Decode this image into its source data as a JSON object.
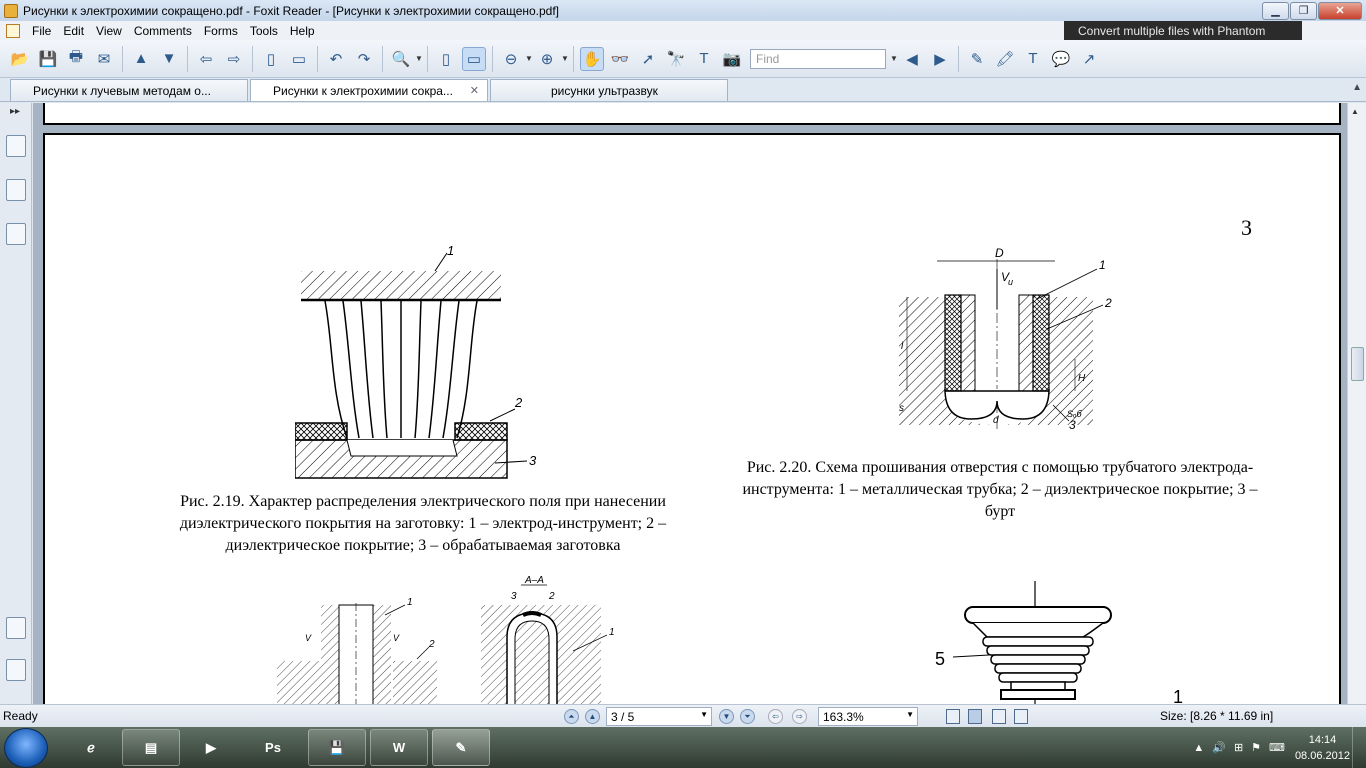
{
  "window": {
    "title": "Рисунки к электрохимии сокращено.pdf - Foxit Reader - [Рисунки к электрохимии сокращено.pdf]",
    "minimize": "▁",
    "maximize": "❐",
    "close": "✕"
  },
  "menu": [
    "File",
    "Edit",
    "View",
    "Comments",
    "Forms",
    "Tools",
    "Help"
  ],
  "promo_text": "Convert multiple files with Phantom",
  "toolbar": {
    "find_placeholder": "Find",
    "icons": {
      "open": "📂",
      "save": "💾",
      "print": "🖶",
      "email": "✉",
      "prev_page": "▲",
      "next_page": "▼",
      "back": "⇦",
      "forward": "⇨",
      "undo": "↶",
      "redo": "↷",
      "zoom_in": "🔍",
      "fit_page": "▯",
      "fit_width": "▭",
      "zoom_out": "⊖",
      "zoom_plus": "⊕",
      "hand": "✋",
      "select_text": "👓",
      "select": "➚",
      "snapshot_find": "🔭",
      "typewriter": "T",
      "camera": "📷",
      "find_prev": "◀",
      "find_next": "▶",
      "note": "✎",
      "highlight": "🖍",
      "textbox": "T",
      "callout": "💬",
      "arrow": "↗"
    }
  },
  "tabs": [
    {
      "label": "Рисунки к лучевым методам о...",
      "active": false
    },
    {
      "label": "Рисунки к электрохимии сокра...",
      "active": true
    },
    {
      "label": "рисунки ультразвук",
      "active": false
    }
  ],
  "document": {
    "page_number": "3",
    "fig_219_caption": "Рис. 2.19. Характер распределения электрического поля при нанесении диэлектрического покрытия на заготовку: 1 – электрод-инструмент; 2 – диэлектрическое покрытие; 3 – обрабатываемая заготовка",
    "fig_220_caption": "Рис. 2.20. Схема прошивания отверстия с помощью трубчатого электрода-инструмента: 1 – металлическая трубка; 2 – диэлектрическое покрытие; 3 – бурт",
    "fig_219_labels": [
      "1",
      "2",
      "3"
    ],
    "fig_220_labels": {
      "D": "D",
      "V": "V",
      "Vsub": "u",
      "one": "1",
      "two": "2",
      "three": "3",
      "l": "l",
      "H": "H",
      "s": "s",
      "d": "d",
      "sb": "Sₒб"
    },
    "fig_221_labels": {
      "aa": "A–A",
      "one_left": "1",
      "two_left": "2",
      "three_right": "3",
      "two_right": "2",
      "one_right": "1",
      "v1": "V",
      "v2": "V"
    },
    "fig_222_labels": {
      "five": "5",
      "one": "1"
    }
  },
  "statusbar": {
    "ready": "Ready",
    "page_display": "3 / 5",
    "zoom": "163.3%",
    "page_size": "Size: [8.26 * 11.69 in]"
  },
  "taskbar": {
    "clock_time": "14:14",
    "clock_date": "08.06.2012",
    "apps": [
      "Internet Explorer",
      "Explorer",
      "Media Player",
      "Ps",
      "Save",
      "W",
      "Foxit Reader"
    ]
  }
}
